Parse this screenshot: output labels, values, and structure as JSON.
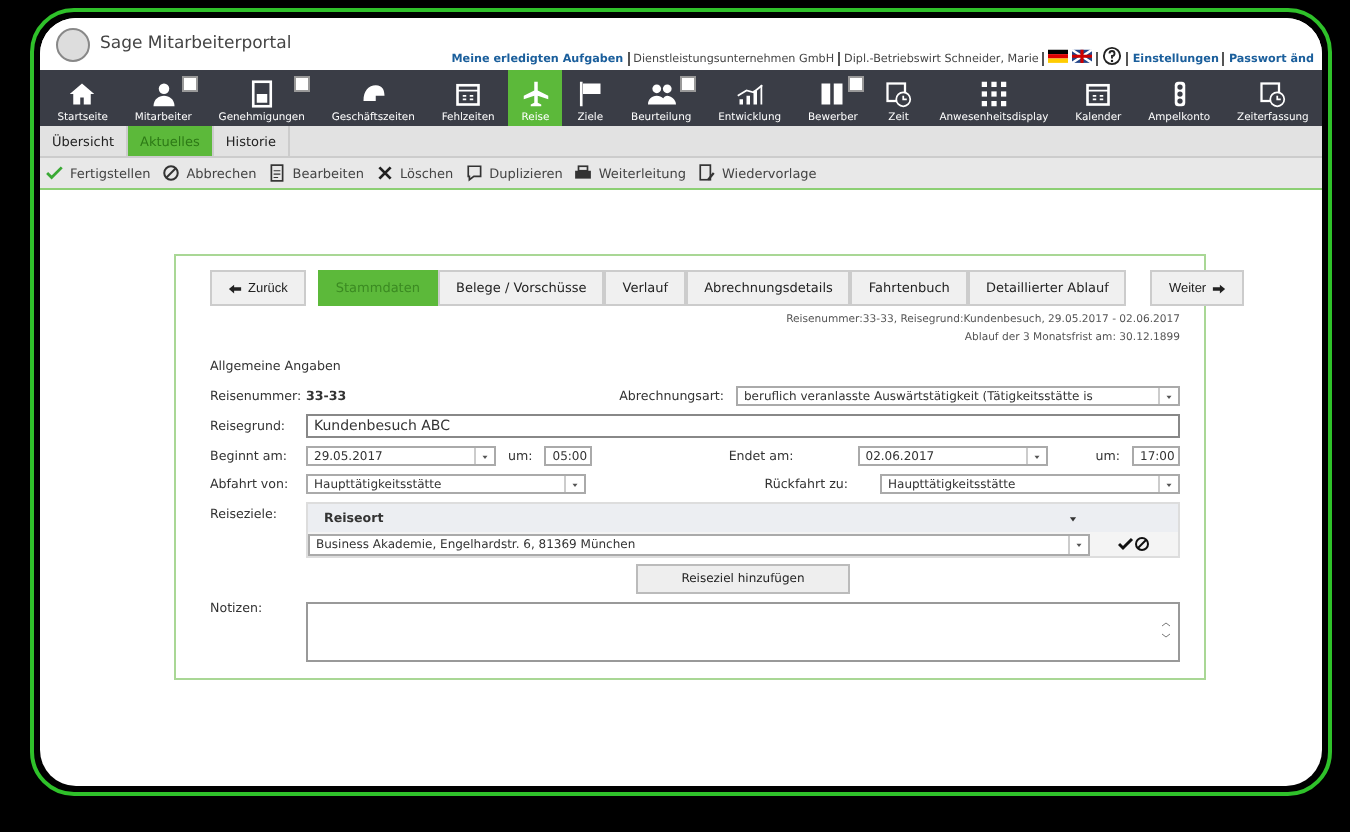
{
  "header": {
    "title": "Sage Mitarbeiterportal",
    "links": [
      {
        "kind": "link",
        "text": "Meine erledigten Aufgaben"
      },
      {
        "kind": "text",
        "text": "Dienstleistungsunternehmen GmbH"
      },
      {
        "kind": "text",
        "text": "Dipl.-Betriebswirt Schneider, Marie"
      },
      {
        "kind": "flags"
      },
      {
        "kind": "help"
      },
      {
        "kind": "link",
        "text": "Einstellungen"
      },
      {
        "kind": "link",
        "text": "Passwort änd"
      }
    ]
  },
  "nav": [
    {
      "label": "Startseite",
      "selected": false,
      "badge": false
    },
    {
      "label": "Mitarbeiter",
      "selected": false,
      "badge": true
    },
    {
      "label": "Genehmigungen",
      "selected": false,
      "badge": true
    },
    {
      "label": "Geschäftszeiten",
      "selected": false,
      "badge": false
    },
    {
      "label": "Fehlzeiten",
      "selected": false,
      "badge": false
    },
    {
      "label": "Reise",
      "selected": true,
      "badge": false
    },
    {
      "label": "Ziele",
      "selected": false,
      "badge": false
    },
    {
      "label": "Beurteilung",
      "selected": false,
      "badge": true
    },
    {
      "label": "Entwicklung",
      "selected": false,
      "badge": false
    },
    {
      "label": "Bewerber",
      "selected": false,
      "badge": true
    },
    {
      "label": "Zeit",
      "selected": false,
      "badge": false
    },
    {
      "label": "Anwesenheitsdisplay",
      "selected": false,
      "badge": false
    },
    {
      "label": "Kalender",
      "selected": false,
      "badge": false
    },
    {
      "label": "Ampelkonto",
      "selected": false,
      "badge": false
    },
    {
      "label": "Zeiterfassung",
      "selected": false,
      "badge": false
    }
  ],
  "subtabs": [
    {
      "label": "Übersicht",
      "selected": false
    },
    {
      "label": "Aktuelles",
      "selected": true
    },
    {
      "label": "Historie",
      "selected": false
    }
  ],
  "toolbar": [
    "Fertigstellen",
    "Abbrechen",
    "Bearbeiten",
    "Löschen",
    "Duplizieren",
    "Weiterleitung",
    "Wiedervorlage"
  ],
  "form": {
    "back": "Zurück",
    "next": "Weiter",
    "tabs": [
      {
        "label": "Stammdaten",
        "selected": true
      },
      {
        "label": "Belege / Vorschüsse",
        "selected": false
      },
      {
        "label": "Verlauf",
        "selected": false
      },
      {
        "label": "Abrechnungsdetails",
        "selected": false
      },
      {
        "label": "Fahrtenbuch",
        "selected": false
      },
      {
        "label": "Detaillierter Ablauf",
        "selected": false
      }
    ],
    "info": [
      "Reisenummer:33-33, Reisegrund:Kundenbesuch, 29.05.2017 - 02.06.2017",
      "Ablauf der 3 Monatsfrist am: 30.12.1899"
    ],
    "section": "Allgemeine Angaben",
    "number_label": "Reisenummer:",
    "number": "33-33",
    "billing_label": "Abrechnungsart:",
    "billing": "beruflich veranlasste Auswärtstätigkeit (Tätigkeitsstätte is",
    "reason_label": "Reisegrund:",
    "reason": "Kundenbesuch ABC",
    "start_label": "Beginnt am:",
    "start_date": "29.05.2017",
    "start_at": "um:",
    "start_time": "05:00",
    "end_label": "Endet am:",
    "end_date": "02.06.2017",
    "end_at": "um:",
    "end_time": "17:00",
    "from_label": "Abfahrt von:",
    "from": "Haupttätigkeitsstätte",
    "to_label": "Rückfahrt zu:",
    "to": "Haupttätigkeitsstätte",
    "dest_label": "Reiseziele:",
    "dest_column": "Reiseort",
    "destinations": [
      "Business Akademie, Engelhardstr. 6, 81369 München"
    ],
    "add": "Reiseziel hinzufügen",
    "notes_label": "Notizen:"
  }
}
